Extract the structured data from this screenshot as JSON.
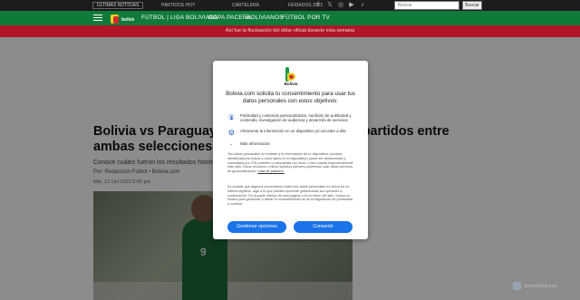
{
  "topbar": {
    "badge": "ÚLTIMAS NOTICIAS",
    "links": [
      "PARTIDOS HOY",
      "CARTELERA",
      "FERIADOS 2022"
    ],
    "social": [
      "facebook-icon",
      "twitter-icon",
      "instagram-icon",
      "youtube-icon",
      "tiktok-icon"
    ],
    "search_placeholder": "Buscar",
    "search_button": "Buscar"
  },
  "nav": {
    "items": [
      "FÚTBOL | LIGA BOLIVIANA",
      "COPA PACEÑA",
      "BOLIVIANOS",
      "FÚTBOL POR TV"
    ]
  },
  "banner": {
    "text": "Así fue la fluctuación del dólar oficial durante esta semana"
  },
  "article": {
    "title": "Bolivia vs Paraguay: Repasa el historial de partidos entre ambas selecciones",
    "subtitle": "Conoce cuáles fueron los resultados históricos de los partidos entre Bolivia y Paraguay.",
    "byline": "Por: Redacción Fútbol • Bolivia.com",
    "date": "Mié, 12 Oct 2022 5:00 pm",
    "photo_number": "9"
  },
  "modal": {
    "logo_text": "Bolivia",
    "heading": "Bolivia.com solicita tu consentimiento para usar tus datos personales con estos objetivos:",
    "purposes": [
      "Publicidad y contenido personalizados, medición de publicidad y contenido, investigación de audiencia y desarrollo de servicios",
      "Almacenar la información en un dispositivo y/o acceder a ella"
    ],
    "more_info": "Más información",
    "paragraph1": "Tus datos personales se tratarán y la información de tu dispositivo (cookies, identificadores únicos y otros datos en el dispositivo) podrá ser almacenada y consultada por 278 partners y compartida con ellos, o bien usarla específicamente este sitio. Estos recursos o estos nuestros partners podremos usar datos precisos de geolocalización.",
    "paragraph1_link": "Lista de partners.",
    "paragraph2": "Es posible que algunos proveedores traten tus datos personales en virtud de un interés legítimo, algo a lo que puedes oponerte gestionando tus opciones a continuación. En la parte inferior de esta página o en el menú del sitio, busca un enlace para gestionar o retirar el consentimiento en la configuración de privacidad y cookies.",
    "manage_button": "Gestionar opciones",
    "consent_button": "Consentir"
  },
  "watermark": "SportsDataLand",
  "colors": {
    "nav_green": "#0f7a3a",
    "banner_red": "#b01628",
    "button_blue": "#1a73e8"
  }
}
